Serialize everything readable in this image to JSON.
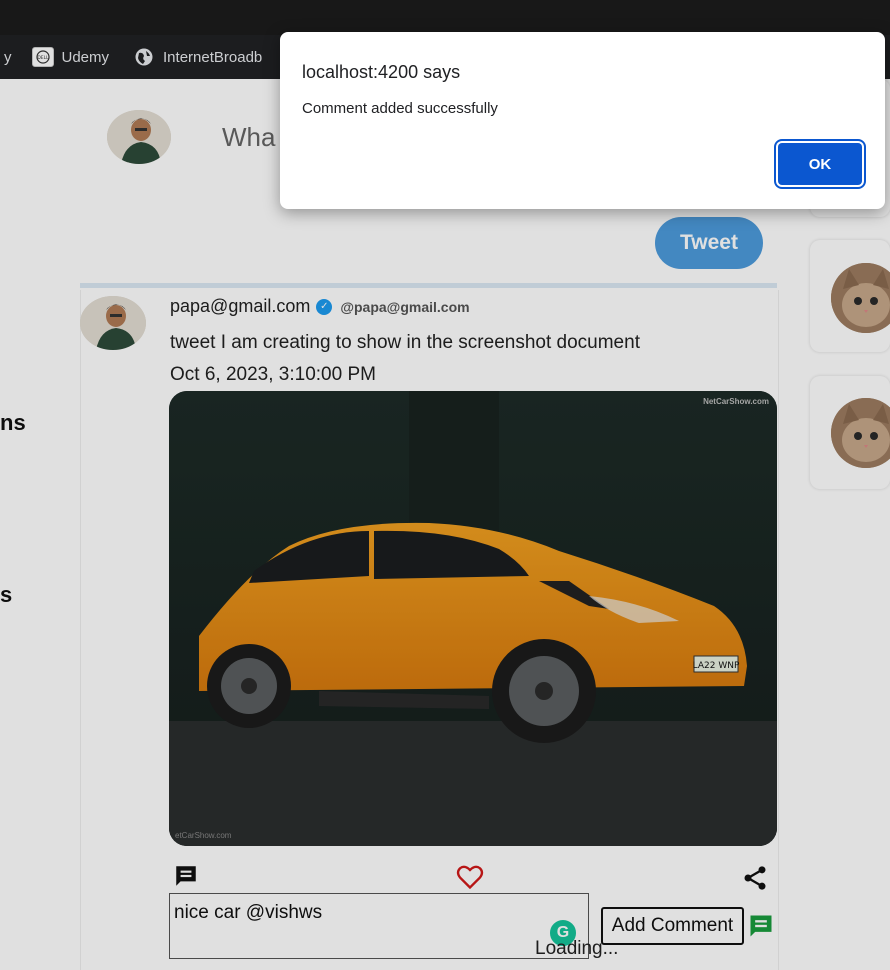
{
  "bookmarks": [
    {
      "label": "y",
      "icon": "truncated-item"
    },
    {
      "label": "Udemy",
      "icon": "dell-icon"
    },
    {
      "label": "InternetBroadb",
      "icon": "globe-icon"
    }
  ],
  "sidebar": {
    "partial_labels": [
      "ns",
      "s"
    ]
  },
  "compose": {
    "placeholder_partial": "Wha",
    "button_label": "Tweet"
  },
  "tweet": {
    "author": "papa@gmail.com",
    "handle": "@papa@gmail.com",
    "text": "tweet I am creating to show in the screenshot document",
    "date": "Oct 6, 2023, 3:10:00 PM",
    "image_watermark": "NetCarShow.com",
    "image_watermark_bottom": "etCarShow.com",
    "plate": "LA22 WNP"
  },
  "comment": {
    "value": "nice car @vishws",
    "button_label": "Add Comment",
    "loading_text": "Loading..."
  },
  "grammarly": {
    "letter": "G"
  },
  "dialog": {
    "title": "localhost:4200 says",
    "message": "Comment added successfully",
    "ok_label": "OK"
  },
  "colors": {
    "accent": "#4d9bdc",
    "heart": "#d11a1a",
    "ok": "#0b57d0",
    "comment_icon_green": "#1a9c3e"
  }
}
